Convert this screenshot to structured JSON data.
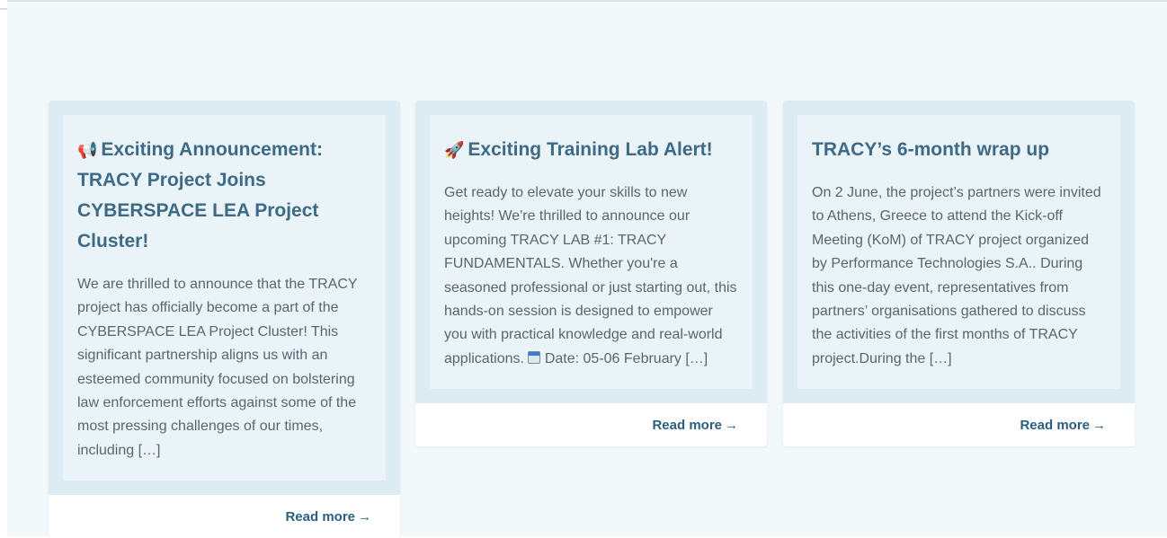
{
  "cards": [
    {
      "icon": "📢",
      "icon_name": "megaphone-icon",
      "title": "Exciting Announcement: TRACY Project Joins CYBERSPACE LEA Project Cluster!",
      "excerpt": "We are thrilled to announce that the TRACY project has officially become a part of the CYBERSPACE LEA Project Cluster! This significant partnership aligns us with an esteemed community focused on bolstering law enforcement efforts against some of the most pressing challenges of our times, including […]",
      "read_more": "Read more",
      "arrow": "→"
    },
    {
      "icon": "🚀",
      "icon_name": "rocket-icon",
      "title": "Exciting Training Lab Alert!",
      "excerpt_before": "Get ready to elevate your skills to new heights! We're thrilled to announce our upcoming TRACY LAB #1: TRACY FUNDAMENTALS. Whether you're a seasoned professional or just starting out, this hands-on session is designed to empower you with practical knowledge and real-world applications. ",
      "excerpt_after": " Date: 05-06 February […]",
      "read_more": "Read more",
      "arrow": "→"
    },
    {
      "title": "TRACY’s 6-month wrap up",
      "excerpt": "On 2 June, the project’s partners were invited to Athens, Greece to attend the Kick-off Meeting (KoM) of TRACY project organized by Performance Technologies S.A.. During this one-day event, representatives from partners’ organisations gathered to discuss the activities of the first months of TRACY project.During the […]",
      "read_more": "Read more",
      "arrow": "→"
    }
  ],
  "colors": {
    "page_bg": "#f3f8fb",
    "card_bg": "#ddebf3",
    "card_inner_bg": "#eaf3f8",
    "title": "#3d6a84",
    "body_text": "#576670",
    "link": "#2b5e7f"
  }
}
